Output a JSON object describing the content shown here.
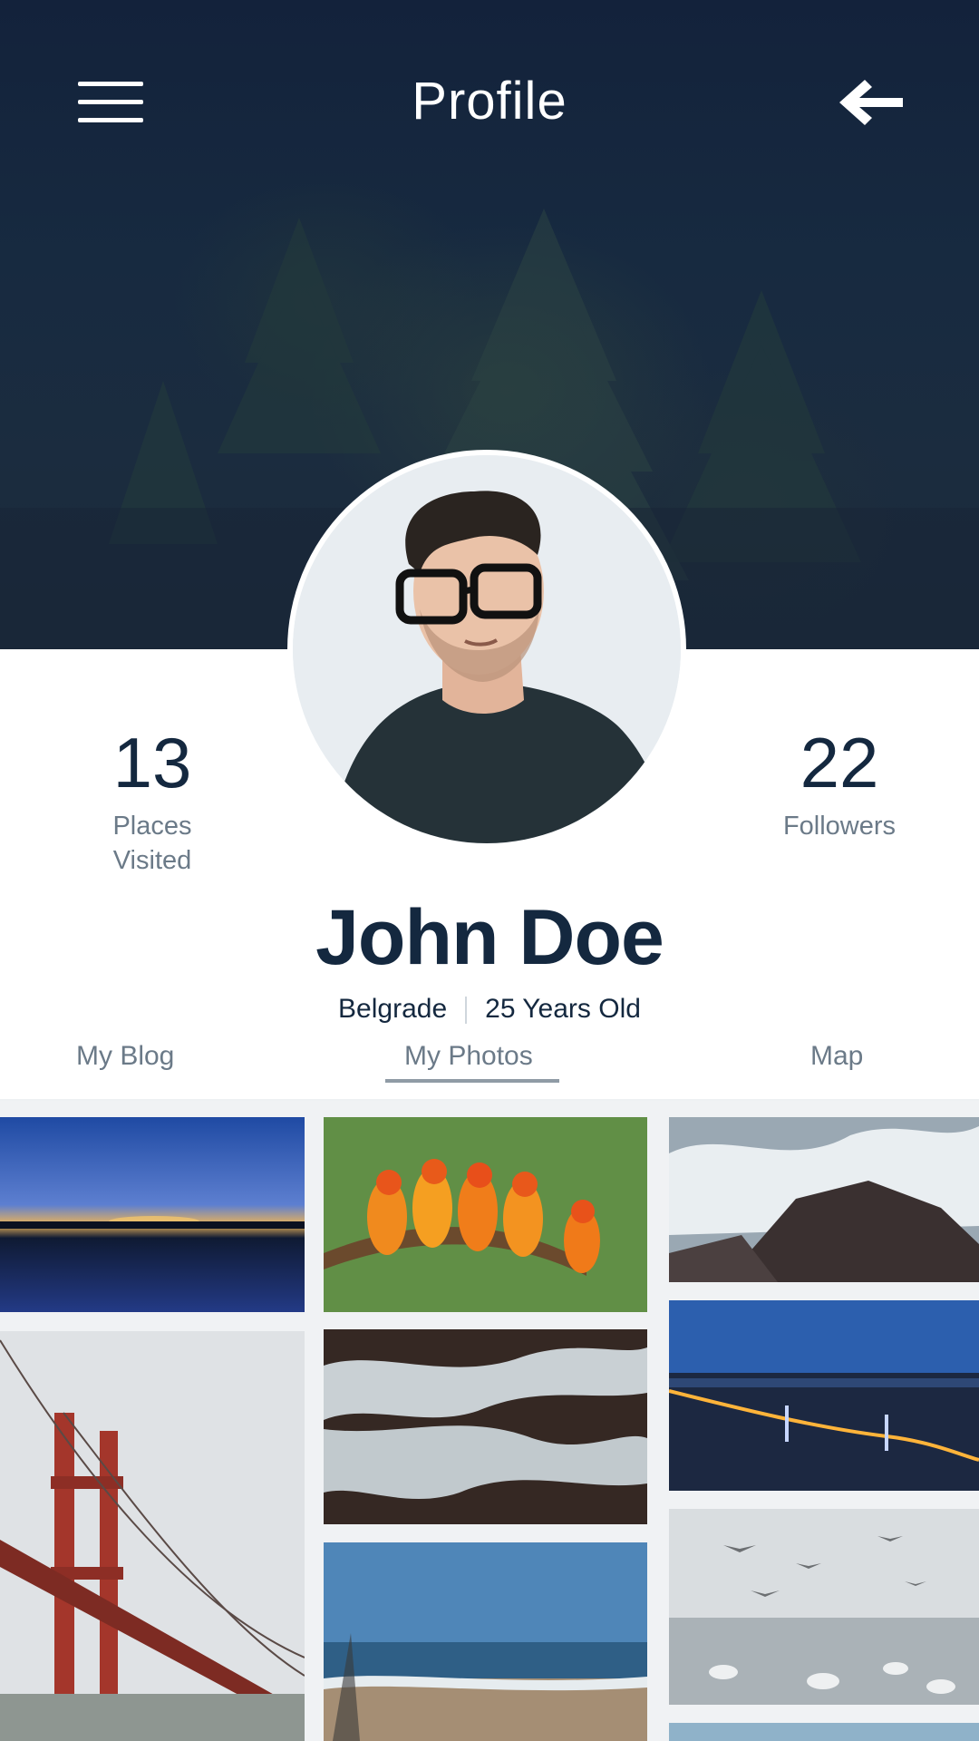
{
  "header": {
    "title": "Profile",
    "menu_icon": "hamburger-menu-icon",
    "back_icon": "arrow-left-icon"
  },
  "profile": {
    "name": "John Doe",
    "city": "Belgrade",
    "age": "25 Years Old",
    "avatar_icon": "profile-avatar"
  },
  "stats": {
    "places_value": "13",
    "places_label_line1": "Places",
    "places_label_line2": "Visited",
    "followers_value": "22",
    "followers_label": "Followers"
  },
  "tabs": [
    {
      "label": "My Blog",
      "active": false
    },
    {
      "label": "My Photos",
      "active": true
    },
    {
      "label": "Map",
      "active": false
    }
  ],
  "photos": [
    {
      "subject": "lake-sunset"
    },
    {
      "subject": "parrots-on-branch"
    },
    {
      "subject": "waves-on-rocks"
    },
    {
      "subject": "golden-gate-bridge"
    },
    {
      "subject": "sea-foam-aerial"
    },
    {
      "subject": "city-bridge-night"
    },
    {
      "subject": "beach-shore"
    },
    {
      "subject": "seagulls-on-water"
    }
  ],
  "colors": {
    "header_bg": "#13223b",
    "primary_text": "#14283f",
    "secondary_text": "#6b7a88",
    "tab_underline": "#8f9ba5"
  }
}
